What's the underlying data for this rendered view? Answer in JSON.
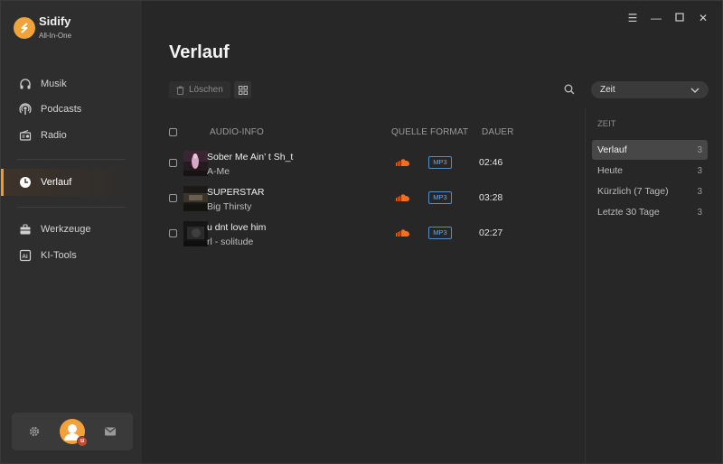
{
  "brand": {
    "name": "Sidify",
    "subtitle": "All-In-One"
  },
  "sidebar": {
    "items": [
      {
        "label": "Musik",
        "icon": "headphones-icon"
      },
      {
        "label": "Podcasts",
        "icon": "podcast-icon"
      },
      {
        "label": "Radio",
        "icon": "radio-icon"
      },
      {
        "label": "Verlauf",
        "icon": "clock-icon",
        "active": true
      },
      {
        "label": "Werkzeuge",
        "icon": "toolbox-icon"
      },
      {
        "label": "KI-Tools",
        "icon": "ai-icon"
      }
    ],
    "bottom": {
      "settings_icon": "gear-icon",
      "avatar_icon": "user-avatar-icon",
      "mail_icon": "mail-icon"
    }
  },
  "window": {
    "controls": [
      "menu-icon",
      "minimize-icon",
      "maximize-icon",
      "close-icon"
    ]
  },
  "main": {
    "title": "Verlauf",
    "toolbar": {
      "delete_label": "Löschen",
      "sort_value": "Zeit"
    },
    "columns": {
      "audio_info": "AUDIO-INFO",
      "source": "QUELLE",
      "format": "FORMAT",
      "duration": "DAUER"
    },
    "rows": [
      {
        "title": "Sober Me Ain’ t Sh_t",
        "artist": "A-Me",
        "format": "MP3",
        "duration": "02:46"
      },
      {
        "title": "SUPERSTAR",
        "artist": "Big Thirsty",
        "format": "MP3",
        "duration": "03:28"
      },
      {
        "title": "u dnt love him",
        "artist": "rl - solitude",
        "format": "MP3",
        "duration": "02:27"
      }
    ]
  },
  "filter": {
    "heading": "ZEIT",
    "items": [
      {
        "label": "Verlauf",
        "count": "3",
        "active": true
      },
      {
        "label": "Heute",
        "count": "3"
      },
      {
        "label": "Kürzlich (7 Tage)",
        "count": "3"
      },
      {
        "label": "Letzte 30 Tage",
        "count": "3"
      }
    ]
  },
  "colors": {
    "accent": "#f39a2b",
    "source_brand": "#f26f23",
    "format_badge": "#4d8fcf"
  }
}
